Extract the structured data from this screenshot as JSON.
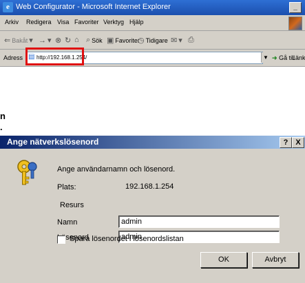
{
  "browser": {
    "title": "Web Configurator - Microsoft Internet Explorer",
    "window_button": "_",
    "menu": [
      "Arkiv",
      "Redigera",
      "Visa",
      "Favoriter",
      "Verktyg",
      "Hjälp"
    ],
    "toolbar": {
      "back": "Bakåt",
      "search": "Sök",
      "favorites": "Favoriter",
      "history": "Tidigare"
    },
    "address_label": "Adress",
    "address_value": "http://192.168.1.254/",
    "go_label": "Gå till",
    "links_label": "Länkar"
  },
  "background_text": [
    "n",
    "."
  ],
  "dialog": {
    "title": "Ange nätverkslösenord",
    "help_button": "?",
    "close_button": "X",
    "prompt": "Ange användarnamn och lösenord.",
    "site_label": "Plats:",
    "site_value": "192.168.1.254",
    "resource_label": "Resurs",
    "username_label": "Namn",
    "username_value": "admin",
    "password_label": "Lösenord",
    "password_value": "admin",
    "save_password_label": "Spara lösenordet i lösenordslistan",
    "save_password_checked": false,
    "ok_label": "OK",
    "cancel_label": "Avbryt"
  },
  "colors": {
    "dialog_title_start": "#0a246a",
    "dialog_title_end": "#a6caf0",
    "highlight": "#e01010"
  }
}
